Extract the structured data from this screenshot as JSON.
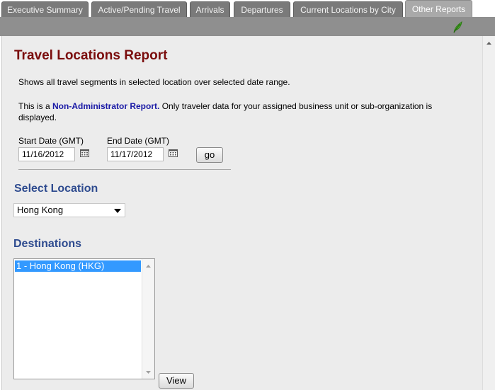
{
  "tabs": [
    {
      "label": "Executive Summary",
      "active": false
    },
    {
      "label": "Active/Pending Travel",
      "active": false
    },
    {
      "label": "Arrivals",
      "active": false
    },
    {
      "label": "Departures",
      "active": false
    },
    {
      "label": "Current Locations by City",
      "active": false
    },
    {
      "label": "Other Reports",
      "active": true
    }
  ],
  "toolbar": {
    "help_icon": "leaf-help-icon"
  },
  "report": {
    "title": "Travel Locations Report",
    "description": "Shows all travel segments in selected location over selected date range.",
    "note_prefix": "This is a ",
    "note_highlight": "Non-Administrator Report.",
    "note_suffix": " Only traveler data for your assigned business unit or sub-organization is displayed."
  },
  "dates": {
    "start_label": "Start Date (GMT)",
    "start_value": "11/16/2012",
    "end_label": "End Date (GMT)",
    "end_value": "11/17/2012",
    "calendar_icon": "calendar-icon",
    "go_label": "go"
  },
  "location": {
    "heading": "Select Location",
    "selected": "Hong Kong"
  },
  "destinations": {
    "heading": "Destinations",
    "items": [
      "1 - Hong Kong (HKG)"
    ],
    "view_label": "View"
  },
  "colors": {
    "title": "#7a0c0c",
    "heading": "#2e4b8f",
    "highlight": "#1a1aa6",
    "selection": "#3399ff"
  }
}
